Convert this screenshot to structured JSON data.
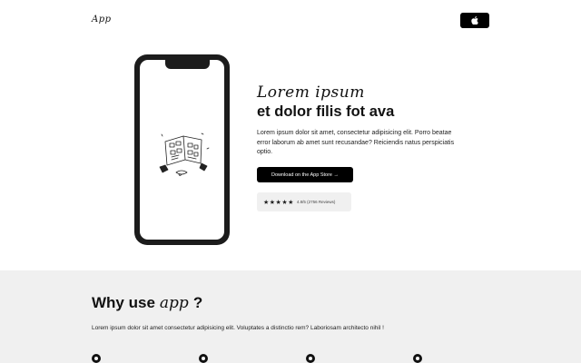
{
  "header": {
    "logo_text": "App",
    "apple_button_icon": "apple-icon"
  },
  "hero": {
    "title_script": "Lorem ipsum",
    "title_bold": "et dolor filis fot ava",
    "description": "Lorem ipsum dolor sit amet, consectetur adipisicing elit. Porro beatae error laborum ab amet sunt recusandae? Reiciendis natus perspiciatis optio.",
    "store_button_label": "Download on the App Store →",
    "rating_stars": "★★★★★",
    "rating_text": "4.8/5 (2756 Reviews)"
  },
  "why": {
    "title_prefix": "Why use",
    "title_script": "app",
    "title_suffix": "?",
    "description": "Lorem ipsum dolor sit amet consectetur adipisicing elit. Voluptates a distinctio rem? Laboriosam architecto nihil !",
    "feature_icons": [
      "feature-icon-1",
      "feature-icon-2",
      "feature-icon-3",
      "feature-icon-4"
    ]
  },
  "colors": {
    "primary": "#000000",
    "section_bg": "#f0f0f0",
    "rating_bg": "#f0f0f0",
    "text": "#111111"
  }
}
